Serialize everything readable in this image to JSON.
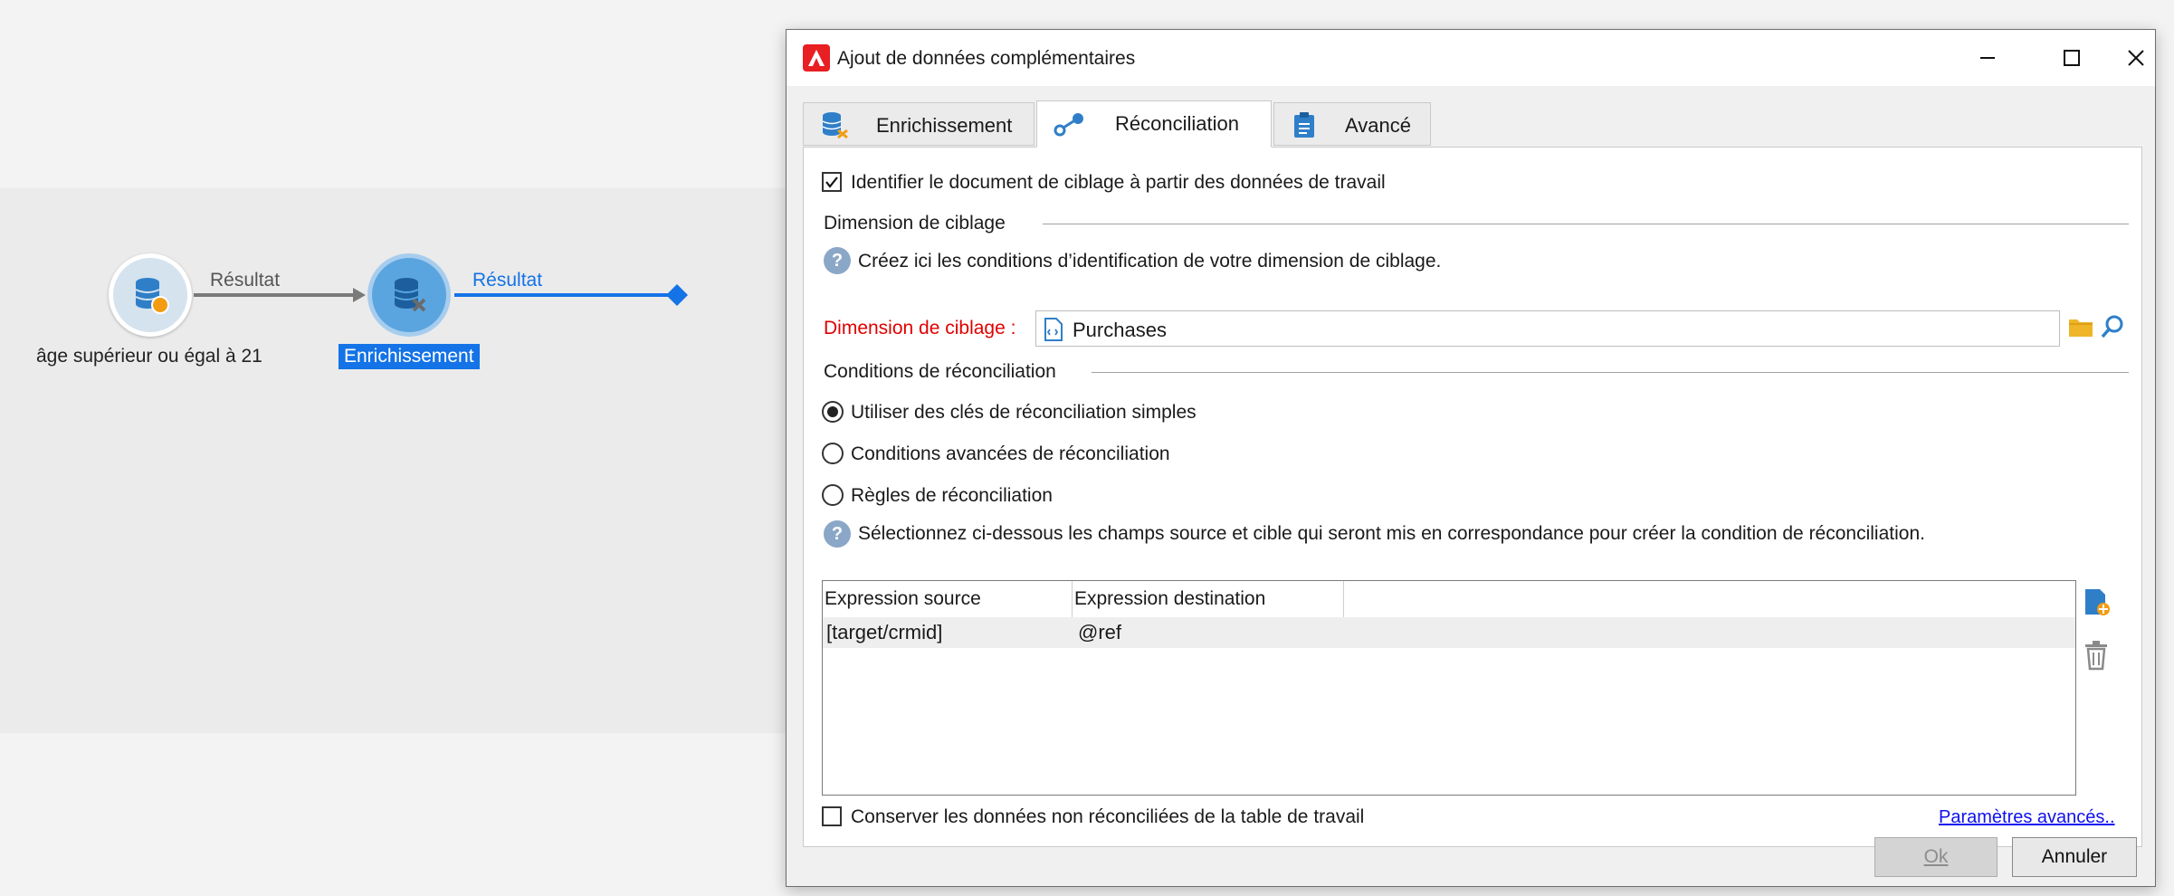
{
  "workflow": {
    "activities": [
      {
        "label": "âge supérieur ou égal à 21"
      },
      {
        "label": "Enrichissement"
      }
    ],
    "transitions": [
      {
        "label": "Résultat"
      },
      {
        "label": "Résultat"
      }
    ]
  },
  "dialog": {
    "title": "Ajout de données complémentaires",
    "tabs": [
      {
        "label": "Enrichissement",
        "icon": "database-enrich-icon"
      },
      {
        "label": "Réconciliation",
        "icon": "link-icon",
        "active": true
      },
      {
        "label": "Avancé",
        "icon": "clipboard-icon"
      }
    ],
    "identify_checkbox": {
      "label": "Identifier le document de ciblage à partir des données de travail",
      "checked": true
    },
    "targeting_group": {
      "title": "Dimension de ciblage",
      "help": "Créez ici les conditions d’identification de votre dimension de ciblage.",
      "field_label": "Dimension de ciblage :",
      "field_value": "Purchases"
    },
    "reconciliation_group": {
      "title": "Conditions de réconciliation",
      "options": [
        {
          "label": "Utiliser des clés de réconciliation simples",
          "selected": true
        },
        {
          "label": "Conditions avancées de réconciliation",
          "selected": false
        },
        {
          "label": "Règles de réconciliation",
          "selected": false
        }
      ],
      "help": "Sélectionnez ci-dessous les champs source et cible qui seront mis en correspondance pour créer la condition de réconciliation."
    },
    "grid": {
      "columns": [
        "Expression source",
        "Expression destination"
      ],
      "rows": [
        {
          "source": "[target/crmid]",
          "destination": "@ref"
        }
      ]
    },
    "keep_checkbox": {
      "label": "Conserver les données non réconciliées de la table de travail",
      "checked": false
    },
    "advanced_link": "Paramètres avancés..",
    "buttons": {
      "ok": "Ok",
      "cancel": "Annuler"
    },
    "colors": {
      "required_label": "#e00000",
      "accent": "#1473e6",
      "link": "#1010ee"
    }
  }
}
